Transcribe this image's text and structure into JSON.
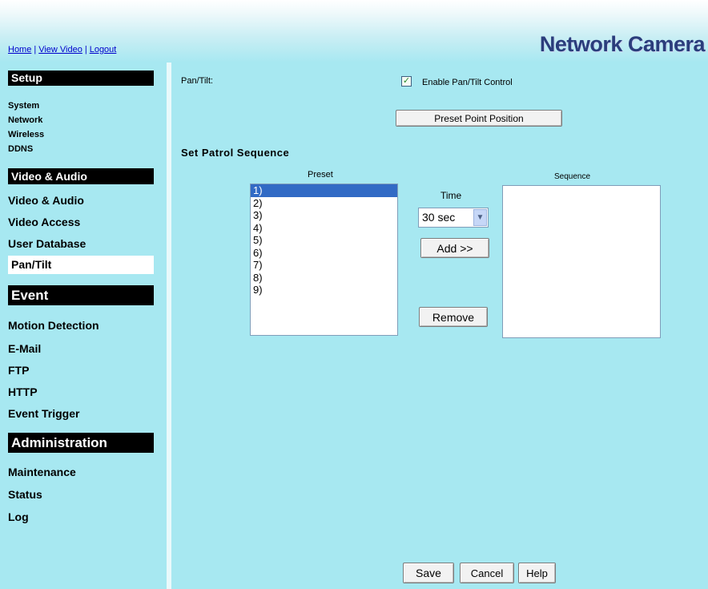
{
  "header": {
    "links": [
      "Home",
      "View Video",
      "Logout"
    ],
    "brand": "Network Camera"
  },
  "sidebar": {
    "setup": {
      "heading": "Setup",
      "items": [
        "System",
        "Network",
        "Wireless",
        "DDNS"
      ]
    },
    "video_audio": {
      "heading": "Video & Audio",
      "items": [
        "Video & Audio",
        "Video Access",
        "User Database",
        "Pan/Tilt"
      ]
    },
    "event": {
      "heading": "Event",
      "items": [
        "Motion Detection",
        "E-Mail",
        "FTP",
        "HTTP",
        "Event Trigger"
      ]
    },
    "administration": {
      "heading": "Administration",
      "items": [
        "Maintenance",
        "Status",
        "Log"
      ]
    },
    "active_item": "Pan/Tilt"
  },
  "content": {
    "pantilt_label": "Pan/Tilt:",
    "enable_checkbox_label": "Enable Pan/Tilt Control",
    "enable_checked": true,
    "preset_button": "Preset Point Position",
    "patrol_title": "Set Patrol Sequence",
    "preset_label": "Preset",
    "preset_options": [
      "1)",
      "2)",
      "3)",
      "4)",
      "5)",
      "6)",
      "7)",
      "8)",
      "9)"
    ],
    "preset_selected_index": 0,
    "time_label": "Time",
    "time_value": "30 sec",
    "add_button": "Add >>",
    "remove_button": "Remove",
    "sequence_label": "Sequence",
    "sequence_items": []
  },
  "footer": {
    "save": "Save",
    "cancel": "Cancel",
    "help": "Help"
  },
  "colors": {
    "background": "#a7e8f1",
    "selection": "#316ac5",
    "link": "#0000cc",
    "brand": "#2a3d7c"
  },
  "icons": {
    "checkbox": "check-icon",
    "select_arrow": "chevron-down-icon"
  }
}
